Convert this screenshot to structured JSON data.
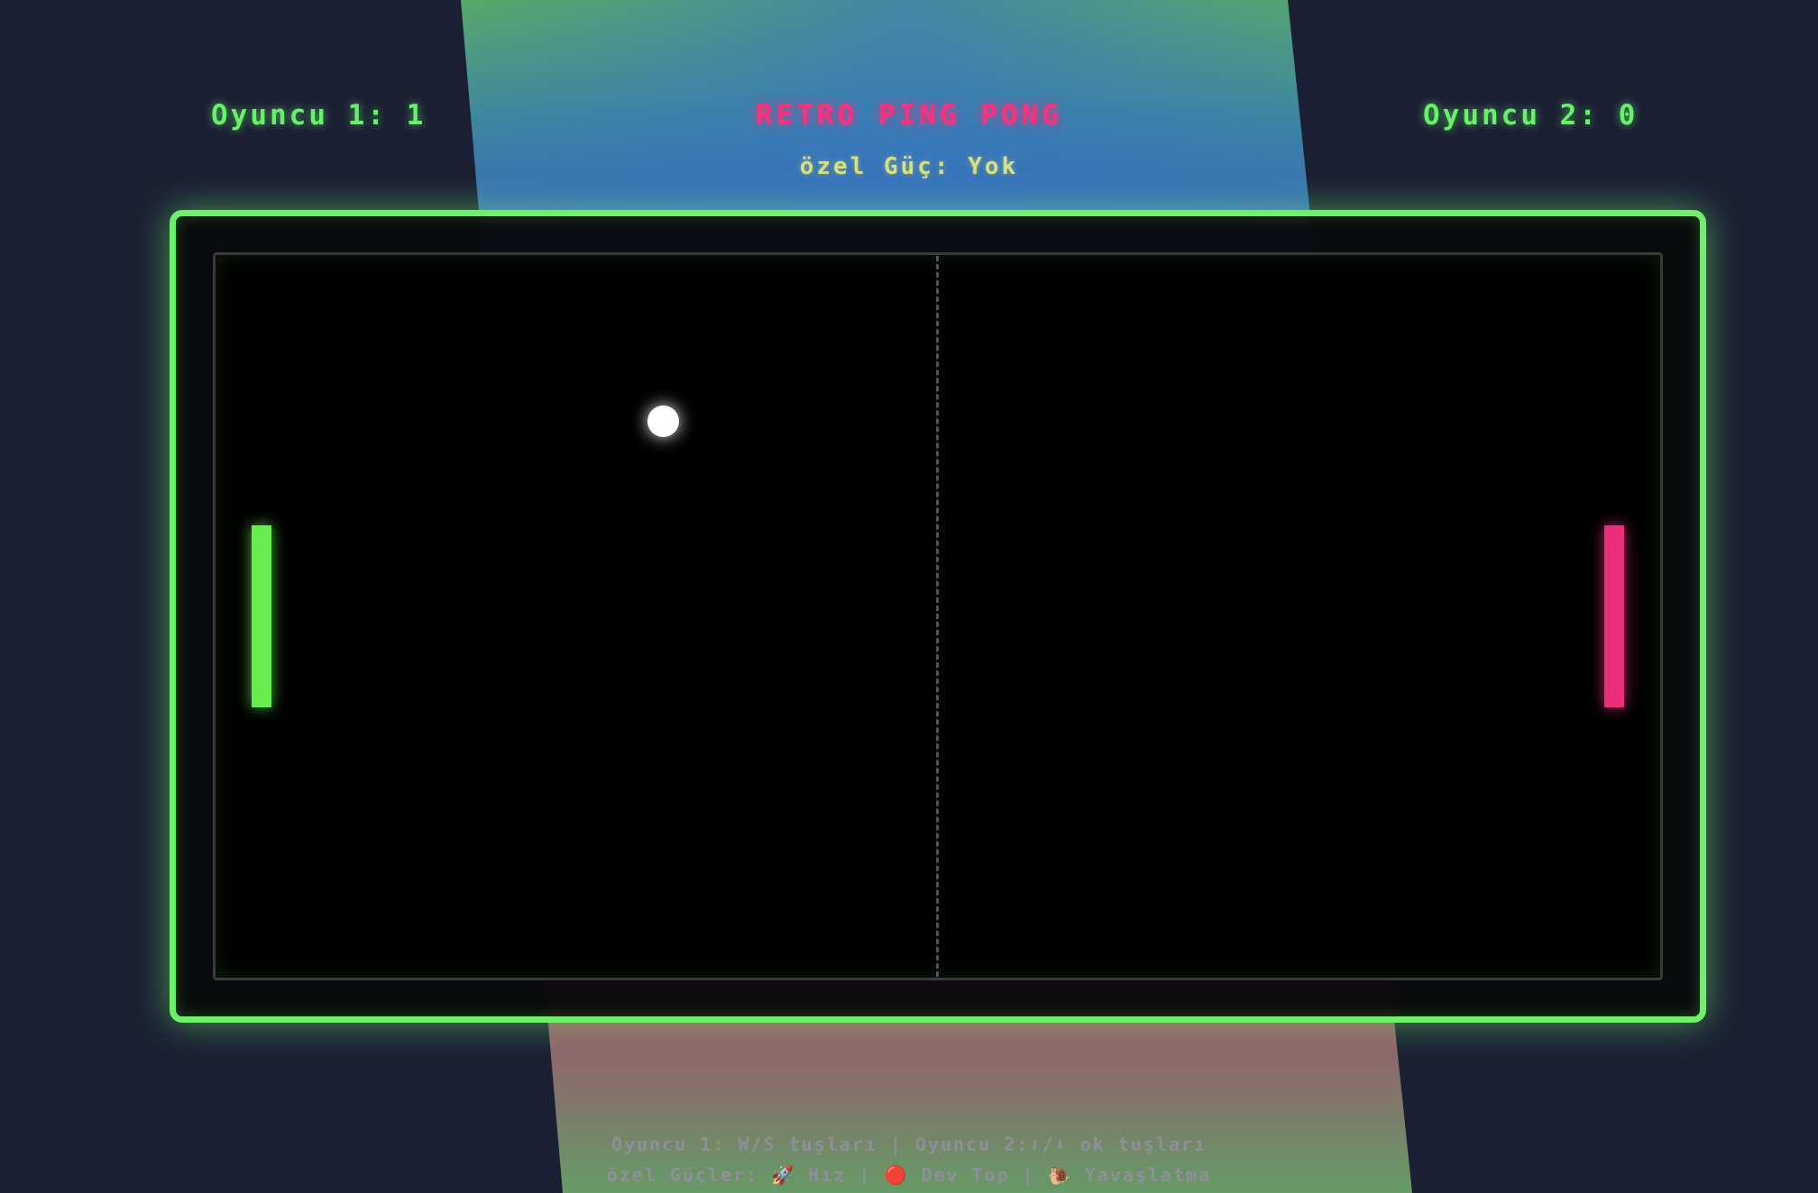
{
  "header": {
    "player1_label": "Oyuncu 1:",
    "player1_score": "1",
    "player2_label": "Oyuncu 2:",
    "player2_score": "0",
    "title": "RETRO PING PONG",
    "power_label": "özel Güç:",
    "power_value": "Yok"
  },
  "game": {
    "left_paddle_color": "#66ee4f",
    "right_paddle_color": "#ec2d7b",
    "frame_color": "#6ef06a",
    "ball_color": "#ffffff"
  },
  "help": {
    "p1_controls": "Oyuncu 1: W/S tuşları",
    "separator": "|",
    "p2_controls_prefix": "Oyuncu 2:",
    "arrow_up": "⬆",
    "arrow_sep": "/",
    "arrow_down": "⬇",
    "p2_controls_suffix": "ok tuşları",
    "powers_label": "özel Güçler:",
    "rocket_icon": "🚀",
    "speed": "Hız",
    "ball_icon": "🔴",
    "big_ball": "Dev Top",
    "snail_icon": "🐌",
    "slow": "Yavaşlatma"
  }
}
